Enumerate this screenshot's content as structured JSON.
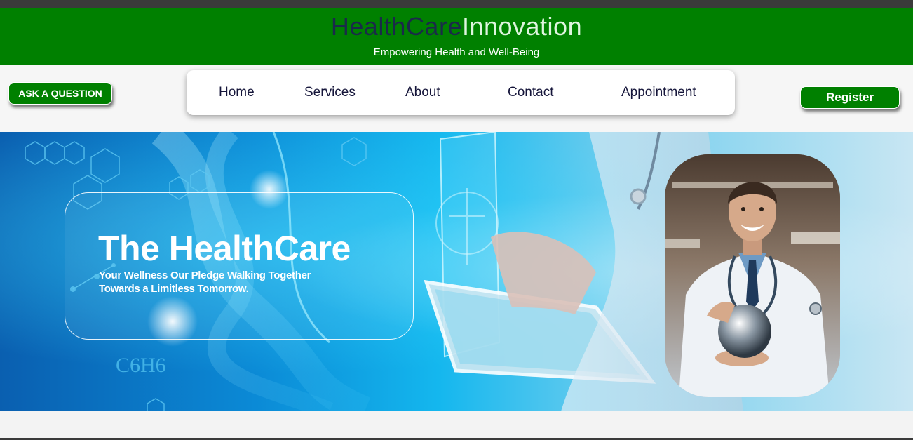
{
  "header": {
    "brand_part1": "HealthCare",
    "brand_part2": "Innovation",
    "tagline": "Empowering Health and Well-Being"
  },
  "buttons": {
    "ask": "ASK A QUESTION",
    "register": "Register"
  },
  "nav": {
    "items": [
      {
        "label": "Home"
      },
      {
        "label": "Services"
      },
      {
        "label": "About"
      },
      {
        "label": "Contact"
      },
      {
        "label": "Appointment"
      }
    ]
  },
  "hero": {
    "title": "The HealthCare",
    "subtitle": "Your Wellness Our Pledge Walking Together Towards a Limitless Tomorrow.",
    "formula_label": "C6H6"
  },
  "colors": {
    "header_bg": "#008000",
    "button_bg": "#008000",
    "brand_dark": "#1a2a4a",
    "brand_light": "#dff5df",
    "nav_text": "#15153a"
  }
}
